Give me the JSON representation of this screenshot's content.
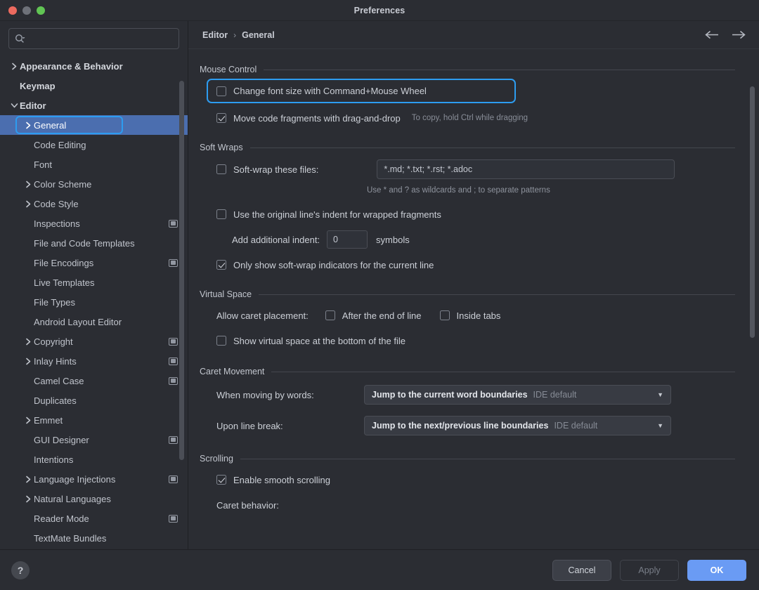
{
  "window": {
    "title": "Preferences",
    "traffic_lights": [
      "close-button",
      "minimize-button",
      "zoom-button"
    ]
  },
  "sidebar": {
    "search": {
      "value": "",
      "placeholder": "",
      "icon": "search-icon"
    },
    "items": [
      {
        "label": "Appearance & Behavior",
        "level": 0,
        "twisty": "chevron-right",
        "badge": false,
        "selected": false
      },
      {
        "label": "Keymap",
        "level": 0,
        "twisty": "none",
        "badge": false,
        "selected": false
      },
      {
        "label": "Editor",
        "level": 0,
        "twisty": "chevron-down",
        "badge": false,
        "selected": false
      },
      {
        "label": "General",
        "level": 1,
        "twisty": "chevron-right",
        "badge": false,
        "selected": true
      },
      {
        "label": "Code Editing",
        "level": 1,
        "twisty": "none",
        "badge": false,
        "selected": false
      },
      {
        "label": "Font",
        "level": 1,
        "twisty": "none",
        "badge": false,
        "selected": false
      },
      {
        "label": "Color Scheme",
        "level": 1,
        "twisty": "chevron-right",
        "badge": false,
        "selected": false
      },
      {
        "label": "Code Style",
        "level": 1,
        "twisty": "chevron-right",
        "badge": false,
        "selected": false
      },
      {
        "label": "Inspections",
        "level": 1,
        "twisty": "none",
        "badge": true,
        "selected": false
      },
      {
        "label": "File and Code Templates",
        "level": 1,
        "twisty": "none",
        "badge": false,
        "selected": false
      },
      {
        "label": "File Encodings",
        "level": 1,
        "twisty": "none",
        "badge": true,
        "selected": false
      },
      {
        "label": "Live Templates",
        "level": 1,
        "twisty": "none",
        "badge": false,
        "selected": false
      },
      {
        "label": "File Types",
        "level": 1,
        "twisty": "none",
        "badge": false,
        "selected": false
      },
      {
        "label": "Android Layout Editor",
        "level": 1,
        "twisty": "none",
        "badge": false,
        "selected": false
      },
      {
        "label": "Copyright",
        "level": 1,
        "twisty": "chevron-right",
        "badge": true,
        "selected": false
      },
      {
        "label": "Inlay Hints",
        "level": 1,
        "twisty": "chevron-right",
        "badge": true,
        "selected": false
      },
      {
        "label": "Camel Case",
        "level": 1,
        "twisty": "none",
        "badge": true,
        "selected": false
      },
      {
        "label": "Duplicates",
        "level": 1,
        "twisty": "none",
        "badge": false,
        "selected": false
      },
      {
        "label": "Emmet",
        "level": 1,
        "twisty": "chevron-right",
        "badge": false,
        "selected": false
      },
      {
        "label": "GUI Designer",
        "level": 1,
        "twisty": "none",
        "badge": true,
        "selected": false
      },
      {
        "label": "Intentions",
        "level": 1,
        "twisty": "none",
        "badge": false,
        "selected": false
      },
      {
        "label": "Language Injections",
        "level": 1,
        "twisty": "chevron-right",
        "badge": true,
        "selected": false
      },
      {
        "label": "Natural Languages",
        "level": 1,
        "twisty": "chevron-right",
        "badge": false,
        "selected": false
      },
      {
        "label": "Reader Mode",
        "level": 1,
        "twisty": "none",
        "badge": true,
        "selected": false
      },
      {
        "label": "TextMate Bundles",
        "level": 1,
        "twisty": "none",
        "badge": false,
        "selected": false
      }
    ]
  },
  "breadcrumb": {
    "parent": "Editor",
    "separator": "›",
    "current": "General",
    "back_icon": "arrow-left-icon",
    "forward_icon": "arrow-right-icon"
  },
  "sections": {
    "mouse_control": {
      "title": "Mouse Control",
      "change_font_size": {
        "label": "Change font size with Command+Mouse Wheel",
        "checked": false,
        "focused": true
      },
      "move_code_fragments": {
        "label": "Move code fragments with drag-and-drop",
        "checked": true
      },
      "move_code_fragments_hint": "To copy, hold Ctrl while dragging"
    },
    "soft_wraps": {
      "title": "Soft Wraps",
      "soft_wrap_files": {
        "label": "Soft-wrap these files:",
        "checked": false
      },
      "soft_wrap_files_value": "*.md; *.txt; *.rst; *.adoc",
      "soft_wrap_files_hint": "Use * and ? as wildcards and ; to separate patterns",
      "original_indent": {
        "label": "Use the original line's indent for wrapped fragments",
        "checked": false
      },
      "additional_indent_label": "Add additional indent:",
      "additional_indent_value": "0",
      "additional_indent_unit": "symbols",
      "only_show_indicators": {
        "label": "Only show soft-wrap indicators for the current line",
        "checked": true
      }
    },
    "virtual_space": {
      "title": "Virtual Space",
      "allow_caret_label": "Allow caret placement:",
      "after_end_of_line": {
        "label": "After the end of line",
        "checked": false
      },
      "inside_tabs": {
        "label": "Inside tabs",
        "checked": false
      },
      "show_virtual_space": {
        "label": "Show virtual space at the bottom of the file",
        "checked": false
      }
    },
    "caret_movement": {
      "title": "Caret Movement",
      "when_moving_by_words_label": "When moving by words:",
      "when_moving_by_words_value": "Jump to the current word boundaries",
      "when_moving_by_words_suffix": "IDE default",
      "upon_line_break_label": "Upon line break:",
      "upon_line_break_value": "Jump to the next/previous line boundaries",
      "upon_line_break_suffix": "IDE default"
    },
    "scrolling": {
      "title": "Scrolling",
      "enable_smooth_scrolling": {
        "label": "Enable smooth scrolling",
        "checked": true
      },
      "caret_behavior_label": "Caret behavior:"
    }
  },
  "footer": {
    "help_label": "?",
    "cancel_label": "Cancel",
    "apply_label": "Apply",
    "ok_label": "OK"
  },
  "colors": {
    "accent_primary": "#6a9bf4",
    "focus_ring": "#2d9cf0",
    "selection": "#4b6eaf",
    "window_bg": "#2b2d33"
  }
}
